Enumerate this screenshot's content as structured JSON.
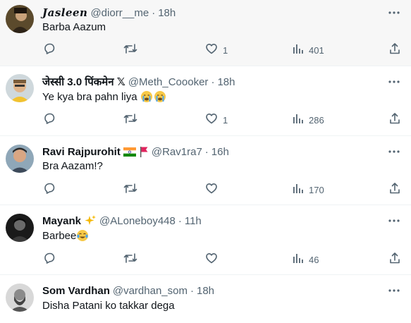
{
  "tweets": [
    {
      "name": "Jasleen",
      "handle": "@diorr__me",
      "dot": "·",
      "time": "18h",
      "text": "Barba Aazum",
      "likes": "1",
      "views": "401",
      "emoji": []
    },
    {
      "name": "जेस्सी 3.0 पिंकमेन 𝕏",
      "handle": "@Meth_Coooker",
      "dot": "·",
      "time": "18h",
      "text": "Ye kya bra pahn liya",
      "likes": "1",
      "views": "286",
      "emoji": [
        "crying-face",
        "crying-face"
      ]
    },
    {
      "name": "Ravi Rajpurohit",
      "handle": "@Rav1ra7",
      "dot": "·",
      "time": "16h",
      "text": "Bra Aazam!?",
      "likes": "",
      "views": "170",
      "emoji": []
    },
    {
      "name": "Mayank",
      "handle": "@ALoneboy448",
      "dot": "·",
      "time": "11h",
      "text": "Barbee",
      "likes": "",
      "views": "46",
      "emoji": [
        "tears-of-joy"
      ]
    },
    {
      "name": "Som Vardhan",
      "handle": "@vardhan_som",
      "dot": "·",
      "time": "18h",
      "text": "Disha Patani ko takkar dega",
      "likes": "",
      "views": "",
      "emoji": []
    }
  ],
  "colors": {
    "text": "#0f1419",
    "muted": "#536471",
    "divider": "#eff3f4",
    "hover_bg": "#f7f7f7"
  }
}
